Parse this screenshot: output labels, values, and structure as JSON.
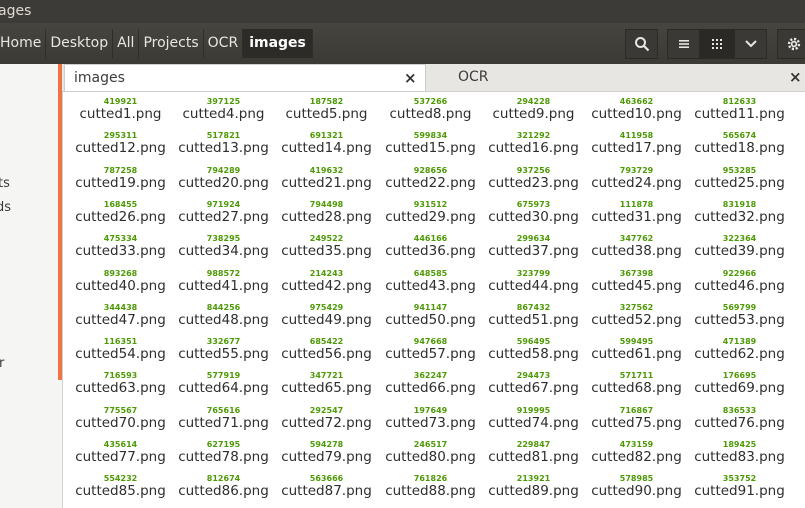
{
  "window": {
    "title": "ages"
  },
  "breadcrumbs": [
    "Home",
    "Desktop",
    "All",
    "Projects",
    "OCR",
    "images"
  ],
  "toolbar_icons": {
    "search": "search-icon",
    "list": "list-view-icon",
    "grid": "grid-view-icon",
    "options": "chevron-down-icon",
    "settings": "gear-icon"
  },
  "sidebar": {
    "fragments": [
      "ts",
      "ds",
      "r"
    ]
  },
  "tabs": [
    {
      "label": "images",
      "close": "×"
    },
    {
      "label": "OCR",
      "close": "×"
    }
  ],
  "colors": {
    "accent": "#ee7447",
    "file_number": "#4e9a06",
    "toolbar": "#3c3b37"
  },
  "files": [
    {
      "num": "419921",
      "name": "cutted1.png"
    },
    {
      "num": "397125",
      "name": "cutted4.png"
    },
    {
      "num": "187582",
      "name": "cutted5.png"
    },
    {
      "num": "537266",
      "name": "cutted8.png"
    },
    {
      "num": "294228",
      "name": "cutted9.png"
    },
    {
      "num": "463662",
      "name": "cutted10.png"
    },
    {
      "num": "812633",
      "name": "cutted11.png"
    },
    {
      "num": "295311",
      "name": "cutted12.png"
    },
    {
      "num": "517821",
      "name": "cutted13.png"
    },
    {
      "num": "691321",
      "name": "cutted14.png"
    },
    {
      "num": "599834",
      "name": "cutted15.png"
    },
    {
      "num": "321292",
      "name": "cutted16.png"
    },
    {
      "num": "411958",
      "name": "cutted17.png"
    },
    {
      "num": "565674",
      "name": "cutted18.png"
    },
    {
      "num": "787258",
      "name": "cutted19.png"
    },
    {
      "num": "794289",
      "name": "cutted20.png"
    },
    {
      "num": "419632",
      "name": "cutted21.png"
    },
    {
      "num": "928656",
      "name": "cutted22.png"
    },
    {
      "num": "937256",
      "name": "cutted23.png"
    },
    {
      "num": "793729",
      "name": "cutted24.png"
    },
    {
      "num": "953285",
      "name": "cutted25.png"
    },
    {
      "num": "168455",
      "name": "cutted26.png"
    },
    {
      "num": "971924",
      "name": "cutted27.png"
    },
    {
      "num": "794498",
      "name": "cutted28.png"
    },
    {
      "num": "931512",
      "name": "cutted29.png"
    },
    {
      "num": "675973",
      "name": "cutted30.png"
    },
    {
      "num": "111878",
      "name": "cutted31.png"
    },
    {
      "num": "831918",
      "name": "cutted32.png"
    },
    {
      "num": "475334",
      "name": "cutted33.png"
    },
    {
      "num": "738295",
      "name": "cutted34.png"
    },
    {
      "num": "249522",
      "name": "cutted35.png"
    },
    {
      "num": "446166",
      "name": "cutted36.png"
    },
    {
      "num": "299634",
      "name": "cutted37.png"
    },
    {
      "num": "347762",
      "name": "cutted38.png"
    },
    {
      "num": "322364",
      "name": "cutted39.png"
    },
    {
      "num": "893268",
      "name": "cutted40.png"
    },
    {
      "num": "988572",
      "name": "cutted41.png"
    },
    {
      "num": "214243",
      "name": "cutted42.png"
    },
    {
      "num": "648585",
      "name": "cutted43.png"
    },
    {
      "num": "323799",
      "name": "cutted44.png"
    },
    {
      "num": "367398",
      "name": "cutted45.png"
    },
    {
      "num": "922966",
      "name": "cutted46.png"
    },
    {
      "num": "344438",
      "name": "cutted47.png"
    },
    {
      "num": "844256",
      "name": "cutted48.png"
    },
    {
      "num": "975429",
      "name": "cutted49.png"
    },
    {
      "num": "941147",
      "name": "cutted50.png"
    },
    {
      "num": "867432",
      "name": "cutted51.png"
    },
    {
      "num": "327562",
      "name": "cutted52.png"
    },
    {
      "num": "569799",
      "name": "cutted53.png"
    },
    {
      "num": "116351",
      "name": "cutted54.png"
    },
    {
      "num": "332677",
      "name": "cutted55.png"
    },
    {
      "num": "685422",
      "name": "cutted56.png"
    },
    {
      "num": "947668",
      "name": "cutted57.png"
    },
    {
      "num": "596495",
      "name": "cutted58.png"
    },
    {
      "num": "599495",
      "name": "cutted61.png"
    },
    {
      "num": "471389",
      "name": "cutted62.png"
    },
    {
      "num": "716593",
      "name": "cutted63.png"
    },
    {
      "num": "577919",
      "name": "cutted64.png"
    },
    {
      "num": "347721",
      "name": "cutted65.png"
    },
    {
      "num": "362247",
      "name": "cutted66.png"
    },
    {
      "num": "294473",
      "name": "cutted67.png"
    },
    {
      "num": "571711",
      "name": "cutted68.png"
    },
    {
      "num": "176695",
      "name": "cutted69.png"
    },
    {
      "num": "775567",
      "name": "cutted70.png"
    },
    {
      "num": "765616",
      "name": "cutted71.png"
    },
    {
      "num": "292547",
      "name": "cutted72.png"
    },
    {
      "num": "197649",
      "name": "cutted73.png"
    },
    {
      "num": "919995",
      "name": "cutted74.png"
    },
    {
      "num": "716867",
      "name": "cutted75.png"
    },
    {
      "num": "836533",
      "name": "cutted76.png"
    },
    {
      "num": "435614",
      "name": "cutted77.png"
    },
    {
      "num": "627195",
      "name": "cutted78.png"
    },
    {
      "num": "594278",
      "name": "cutted79.png"
    },
    {
      "num": "246517",
      "name": "cutted80.png"
    },
    {
      "num": "229847",
      "name": "cutted81.png"
    },
    {
      "num": "473159",
      "name": "cutted82.png"
    },
    {
      "num": "189425",
      "name": "cutted83.png"
    },
    {
      "num": "554232",
      "name": "cutted85.png"
    },
    {
      "num": "812674",
      "name": "cutted86.png"
    },
    {
      "num": "563666",
      "name": "cutted87.png"
    },
    {
      "num": "761826",
      "name": "cutted88.png"
    },
    {
      "num": "213921",
      "name": "cutted89.png"
    },
    {
      "num": "578985",
      "name": "cutted90.png"
    },
    {
      "num": "353752",
      "name": "cutted91.png"
    }
  ]
}
